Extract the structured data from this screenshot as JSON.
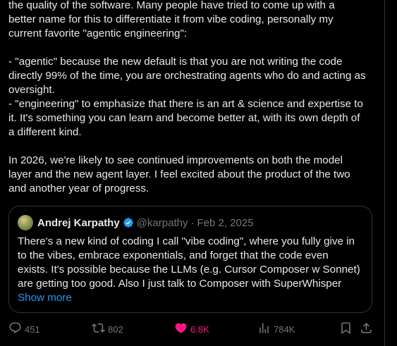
{
  "post": {
    "lines_a": "the quality of the software. Many people have tried to come up with a\nbetter name for this to differentiate it from vibe coding, personally my\ncurrent favorite \"agentic engineering\":",
    "lines_b": "- \"agentic\" because the new default is that you are not writing the code\ndirectly 99% of the time, you are orchestrating agents who do and acting as\noversight.\n- \"engineering\" to emphasize that there is an art & science and expertise to\nit. It's something you can learn and become better at, with its own depth of\na different kind.",
    "lines_c": "In 2026, we're likely to see continued improvements on both the model\nlayer and the new agent layer. I feel excited about the product of the two\nand another year of progress."
  },
  "quote": {
    "author_name": "Andrej Karpathy",
    "handle": "@karpathy",
    "separator": "·",
    "date": "Feb 2, 2025",
    "text": "There's a new kind of coding I call \"vibe coding\", where you fully give in\nto the vibes, embrace exponentials, and forget that the code even\nexists. It's possible because the LLMs (e.g. Cursor Composer w Sonnet)\nare getting too good. Also I just talk to Composer with SuperWhisper",
    "show_more": "Show more"
  },
  "actions": {
    "replies": "451",
    "reposts": "802",
    "likes": "6.8K",
    "views": "784K"
  },
  "icons": {
    "reply": "reply-icon",
    "repost": "repost-icon",
    "like": "heart-icon",
    "views": "views-icon",
    "bookmark": "bookmark-icon",
    "share": "share-icon",
    "verified": "verified-badge-icon"
  },
  "colors": {
    "background": "#000000",
    "text": "#e7e9ea",
    "muted": "#71767b",
    "link": "#1d9bf0",
    "like": "#f91880",
    "border": "#2f3336"
  }
}
